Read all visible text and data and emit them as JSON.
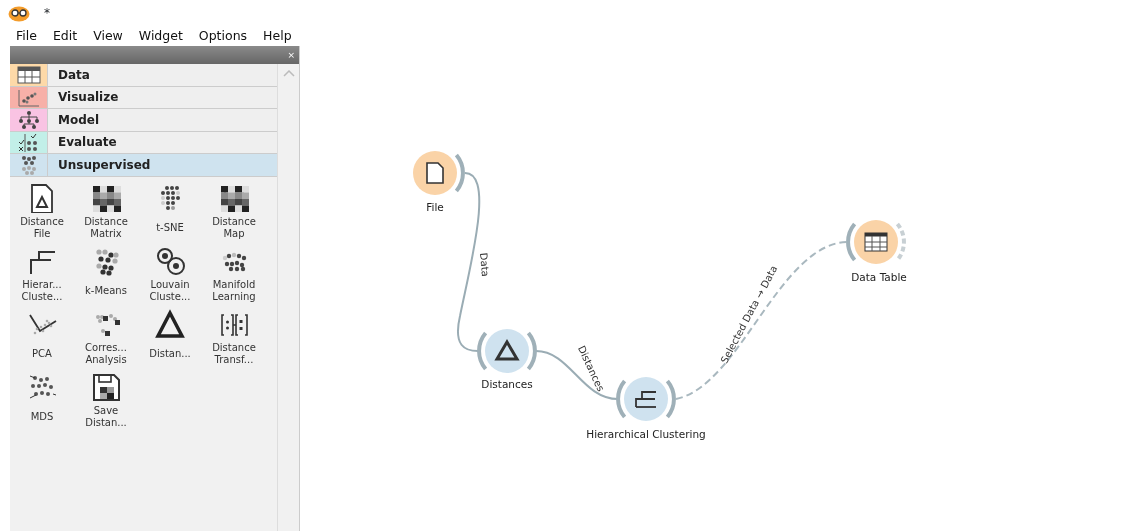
{
  "window": {
    "title": "*"
  },
  "menu": [
    "File",
    "Edit",
    "View",
    "Widget",
    "Options",
    "Help"
  ],
  "dock": {
    "close": "×"
  },
  "categories": [
    {
      "label": "Data",
      "color": "#fdd9a8",
      "selected": false
    },
    {
      "label": "Visualize",
      "color": "#f7b0a8",
      "selected": false
    },
    {
      "label": "Model",
      "color": "#f9c3e3",
      "selected": false
    },
    {
      "label": "Evaluate",
      "color": "#c2efe8",
      "selected": false
    },
    {
      "label": "Unsupervised",
      "color": "#cfe3ef",
      "selected": true
    }
  ],
  "widgets": [
    {
      "label": "Distance File"
    },
    {
      "label": "Distance Matrix"
    },
    {
      "label": "t-SNE"
    },
    {
      "label": "Distance Map"
    },
    {
      "label": "Hierar... Cluste..."
    },
    {
      "label": "k-Means"
    },
    {
      "label": "Louvain Cluste..."
    },
    {
      "label": "Manifold Learning"
    },
    {
      "label": "PCA"
    },
    {
      "label": "Corres... Analysis"
    },
    {
      "label": "Distan..."
    },
    {
      "label": "Distance Transf..."
    },
    {
      "label": "MDS"
    },
    {
      "label": "Save Distan..."
    }
  ],
  "canvas": {
    "nodes": [
      {
        "label": "File",
        "color": "#fad3a7",
        "has_input": false,
        "output_linked": true
      },
      {
        "label": "Distances",
        "color": "#cfe2ef",
        "has_input": true,
        "output_linked": true
      },
      {
        "label": "Hierarchical Clustering",
        "color": "#cfe2ef",
        "has_input": true,
        "output_linked": true
      },
      {
        "label": "Data Table",
        "color": "#fad3a7",
        "has_input": true,
        "output_linked": false
      }
    ],
    "links": [
      {
        "label": "Data",
        "active": true
      },
      {
        "label": "Distances",
        "active": true
      },
      {
        "label": "Selected Data → Data",
        "active": false
      }
    ]
  }
}
